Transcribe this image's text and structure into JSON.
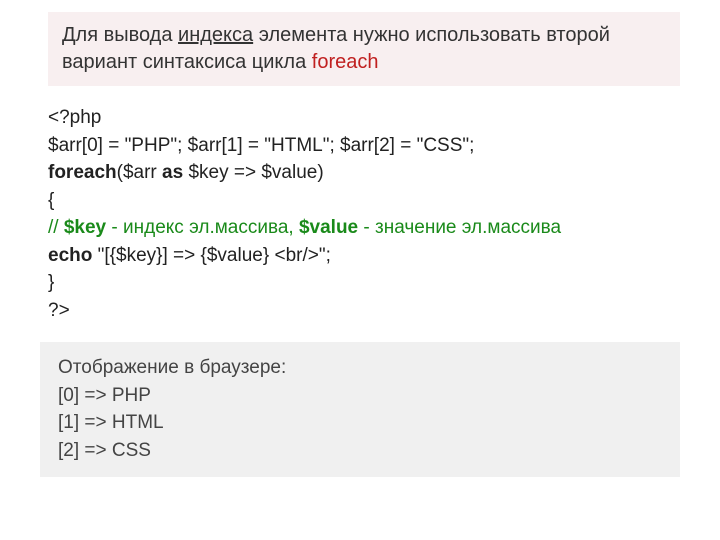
{
  "header": {
    "text_prefix": "Для вывода ",
    "text_index": "индекса",
    "text_mid": " элемента нужно использовать второй вариант синтаксиса цикла ",
    "text_foreach": "foreach"
  },
  "code": {
    "l1": "<?php",
    "l2": "$arr[0] = \"PHP\"; $arr[1] = \"HTML\"; $arr[2] = \"CSS\";",
    "l3a": "foreach",
    "l3b": "($arr ",
    "l3c": "as",
    "l3d": " $key => $value)",
    "l4": "{",
    "l5a": "// ",
    "l5b": "$key",
    "l5c": " - индекс эл.массива, ",
    "l5d": "$value",
    "l5e": " - значение эл.массива",
    "l6a": "echo",
    "l6b": " \"[{$key}] => {$value} <br/>\";",
    "l7": "}",
    "l8": "?>"
  },
  "output": {
    "title": "Отображение в браузере:",
    "lines": [
      "[0] => PHP",
      "[1] => HTML",
      "[2] => CSS"
    ]
  }
}
